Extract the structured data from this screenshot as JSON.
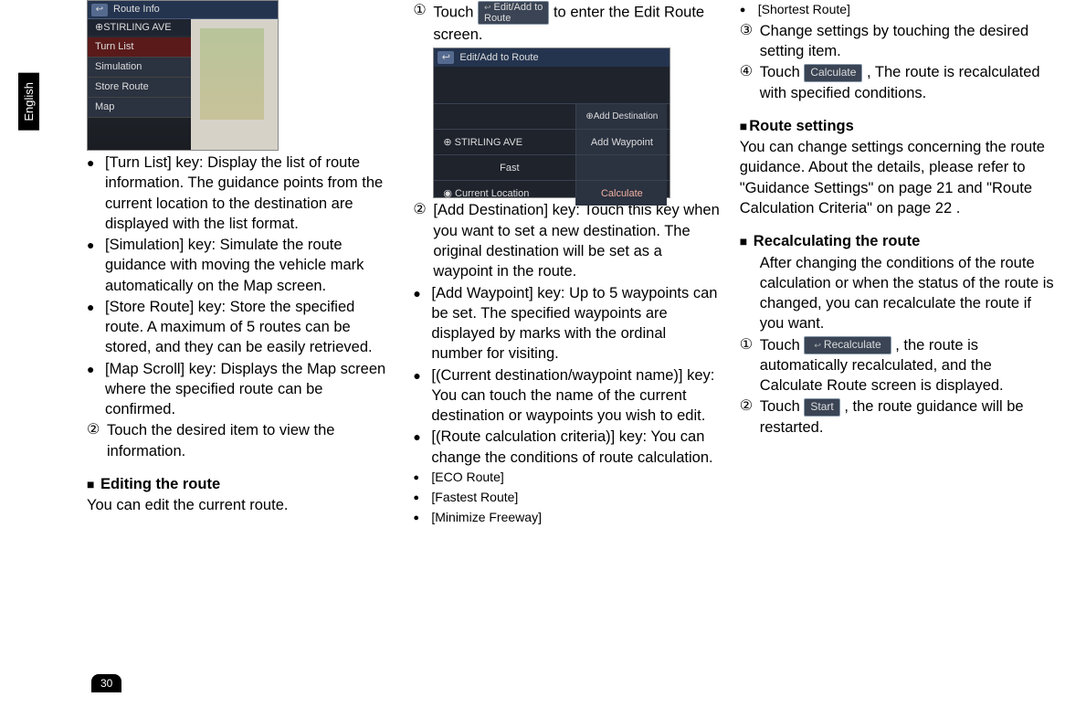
{
  "side_tab": "English",
  "page_number": "30",
  "screen1": {
    "title": "Route Info",
    "top_label": "STIRLING AVE",
    "menu": [
      "Turn List",
      "Simulation",
      "Store Route",
      "Map"
    ]
  },
  "col1": {
    "b1": "[Turn List] key: Display the list of route information. The guidance points from the current location to the destination are displayed with the list format.",
    "b2": "[Simulation] key:  Simulate the route guidance with moving the vehicle mark automatically on the Map screen.",
    "b3": "[Store Route] key: Store the speci­fied route. A maximum of 5 routes can be stored, and they can be easily retrieved.",
    "b4": "[Map Scroll] key: Displays the Map screen where the specified route can be confirmed.",
    "n2": " Touch the desired item to view the information.",
    "h1": " Editing the route",
    "p1": "You can edit the current route."
  },
  "col2": {
    "n1a": "Touch ",
    "n1b": " to enter the Edit Route screen.",
    "btn_edit_l1": "Edit/Add to",
    "btn_edit_l2": "Route",
    "n2": "[Add Destination] key: Touch this key when you want to set a new destination. The original destina­tion will be set as a waypoint in the route.",
    "b1": "[Add Waypoint] key: Up to 5 way­points can be set. The specified waypoints are displayed by marks with the ordinal number for visiting.",
    "b2": "[(Current destination/waypoint name)] key: You can touch the name of the current destination or waypoints you wish to edit.",
    "b3": "[(Route calculation criteria)] key: You can change the conditions of route calculation.",
    "s1": "[ECO Route]",
    "s2": "[Fastest Route]",
    "s3": "[Minimize Freeway]"
  },
  "screen2": {
    "title": "Edit/Add to Route",
    "row_dest": "Add Destination",
    "row1_l": "STIRLING AVE",
    "row1_r": "Add Waypoint",
    "row2_l": "Fast",
    "row3_l": "Current Location",
    "row3_r": "Calculate"
  },
  "col3": {
    "s1": "[Shortest Route]",
    "n3": "Change settings by touching the desired setting item.",
    "n4a": "Touch ",
    "n4b": ", The route is recal­culated with specified conditions.",
    "btn_calc": "Calculate",
    "h1": "Route settings",
    "p1": "You can change settings concerning the route guidance. About the details, please refer to \"Guidance Settings\" on page  21 and \"Route Calculation Criteria\" on page  22 .",
    "h2": " Recalculating the route",
    "p2": "After changing the conditions of the route calculation or when the status of the route is changed, you can recalculate the route if you want.",
    "n1a": "Touch ",
    "n1b": ", the route is automatically recalculated, and the Calculate Route screen is displayed.",
    "btn_recalc": "Recalculate",
    "n2a": "Touch ",
    "n2b": ", the route guidance will be restarted.",
    "btn_start": "Start"
  }
}
